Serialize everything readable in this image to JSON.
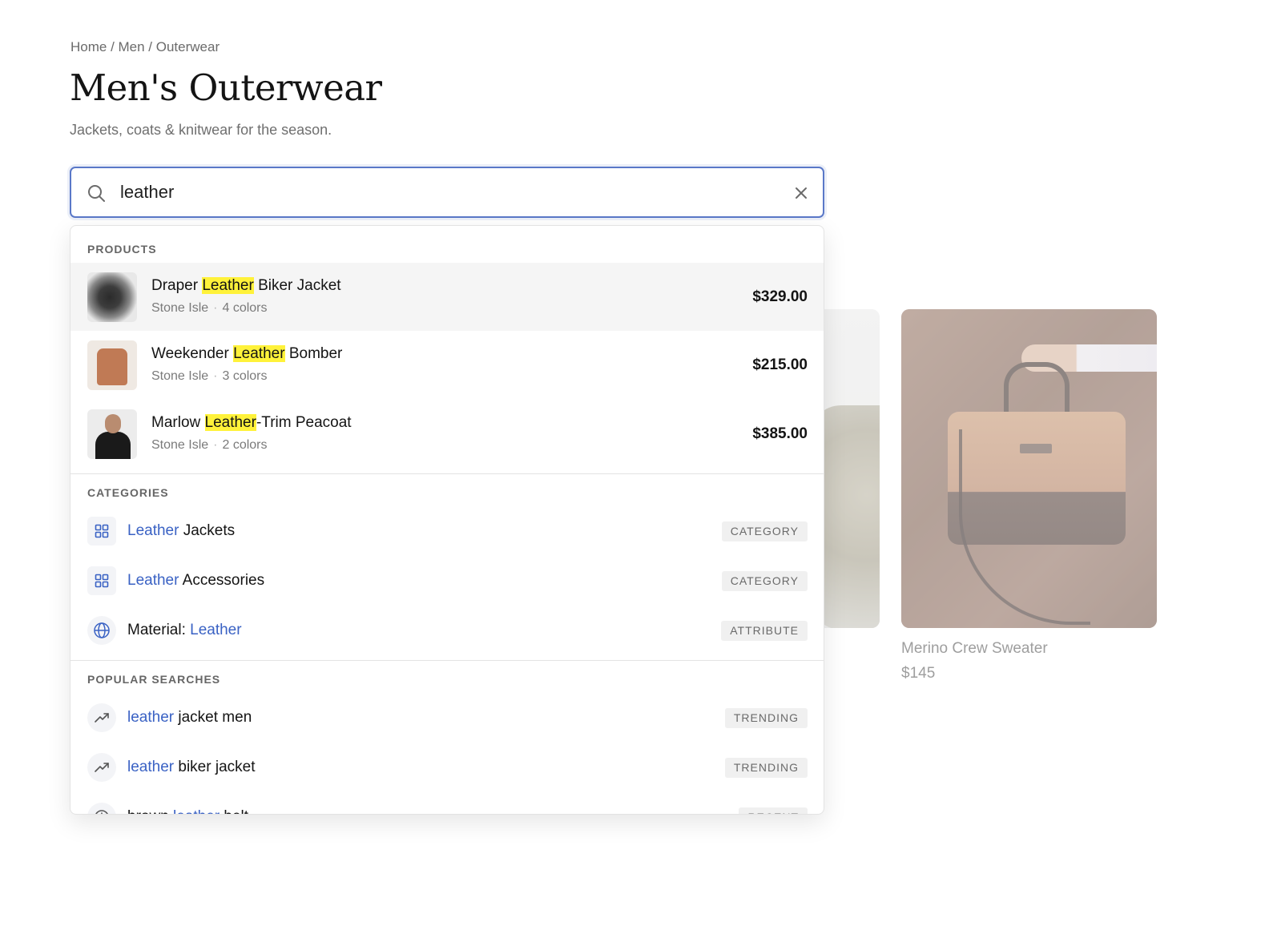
{
  "breadcrumb": "Home / Men / Outerwear",
  "page": {
    "title": "Men's Outerwear",
    "subtitle": "Jackets, coats & knitwear for the season."
  },
  "search": {
    "value": "leather",
    "placeholder": ""
  },
  "background_products": [
    {
      "name": "",
      "price": ""
    },
    {
      "name": "Merino Crew Sweater",
      "price": "$145"
    }
  ],
  "dropdown": {
    "products_title": "PRODUCTS",
    "products": [
      {
        "name_before": "Draper ",
        "name_match": "Leather",
        "name_after": " Biker Jacket",
        "brand": "Stone Isle",
        "colors": "4 colors",
        "price": "$329.00"
      },
      {
        "name_before": "Weekender ",
        "name_match": "Leather",
        "name_after": " Bomber",
        "brand": "Stone Isle",
        "colors": "3 colors",
        "price": "$215.00"
      },
      {
        "name_before": "Marlow ",
        "name_match": "Leather",
        "name_after": "-Trim Peacoat",
        "brand": "Stone Isle",
        "colors": "2 colors",
        "price": "$385.00"
      }
    ],
    "categories_title": "CATEGORIES",
    "categories": [
      {
        "before": "",
        "match": "Leather",
        "after": " Jackets",
        "badge": "CATEGORY",
        "icon": "grid-icon"
      },
      {
        "before": "",
        "match": "Leather",
        "after": " Accessories",
        "badge": "CATEGORY",
        "icon": "grid-icon"
      },
      {
        "before": "Material: ",
        "match": "Leather",
        "after": "",
        "badge": "ATTRIBUTE",
        "icon": "globe-icon"
      }
    ],
    "popular_title": "POPULAR SEARCHES",
    "popular": [
      {
        "match": "leather",
        "after": " jacket men",
        "badge": "TRENDING",
        "icon": "trending-icon"
      },
      {
        "match": "leather",
        "after": " biker jacket",
        "badge": "TRENDING",
        "icon": "trending-icon"
      },
      {
        "before": "brown ",
        "match": "leather",
        "after": " belt",
        "badge": "RECENT",
        "icon": "clock-icon"
      }
    ]
  },
  "colors": {
    "accent": "#3a62c4",
    "highlight": "#fff23a",
    "focus_border": "#5a78c8"
  }
}
